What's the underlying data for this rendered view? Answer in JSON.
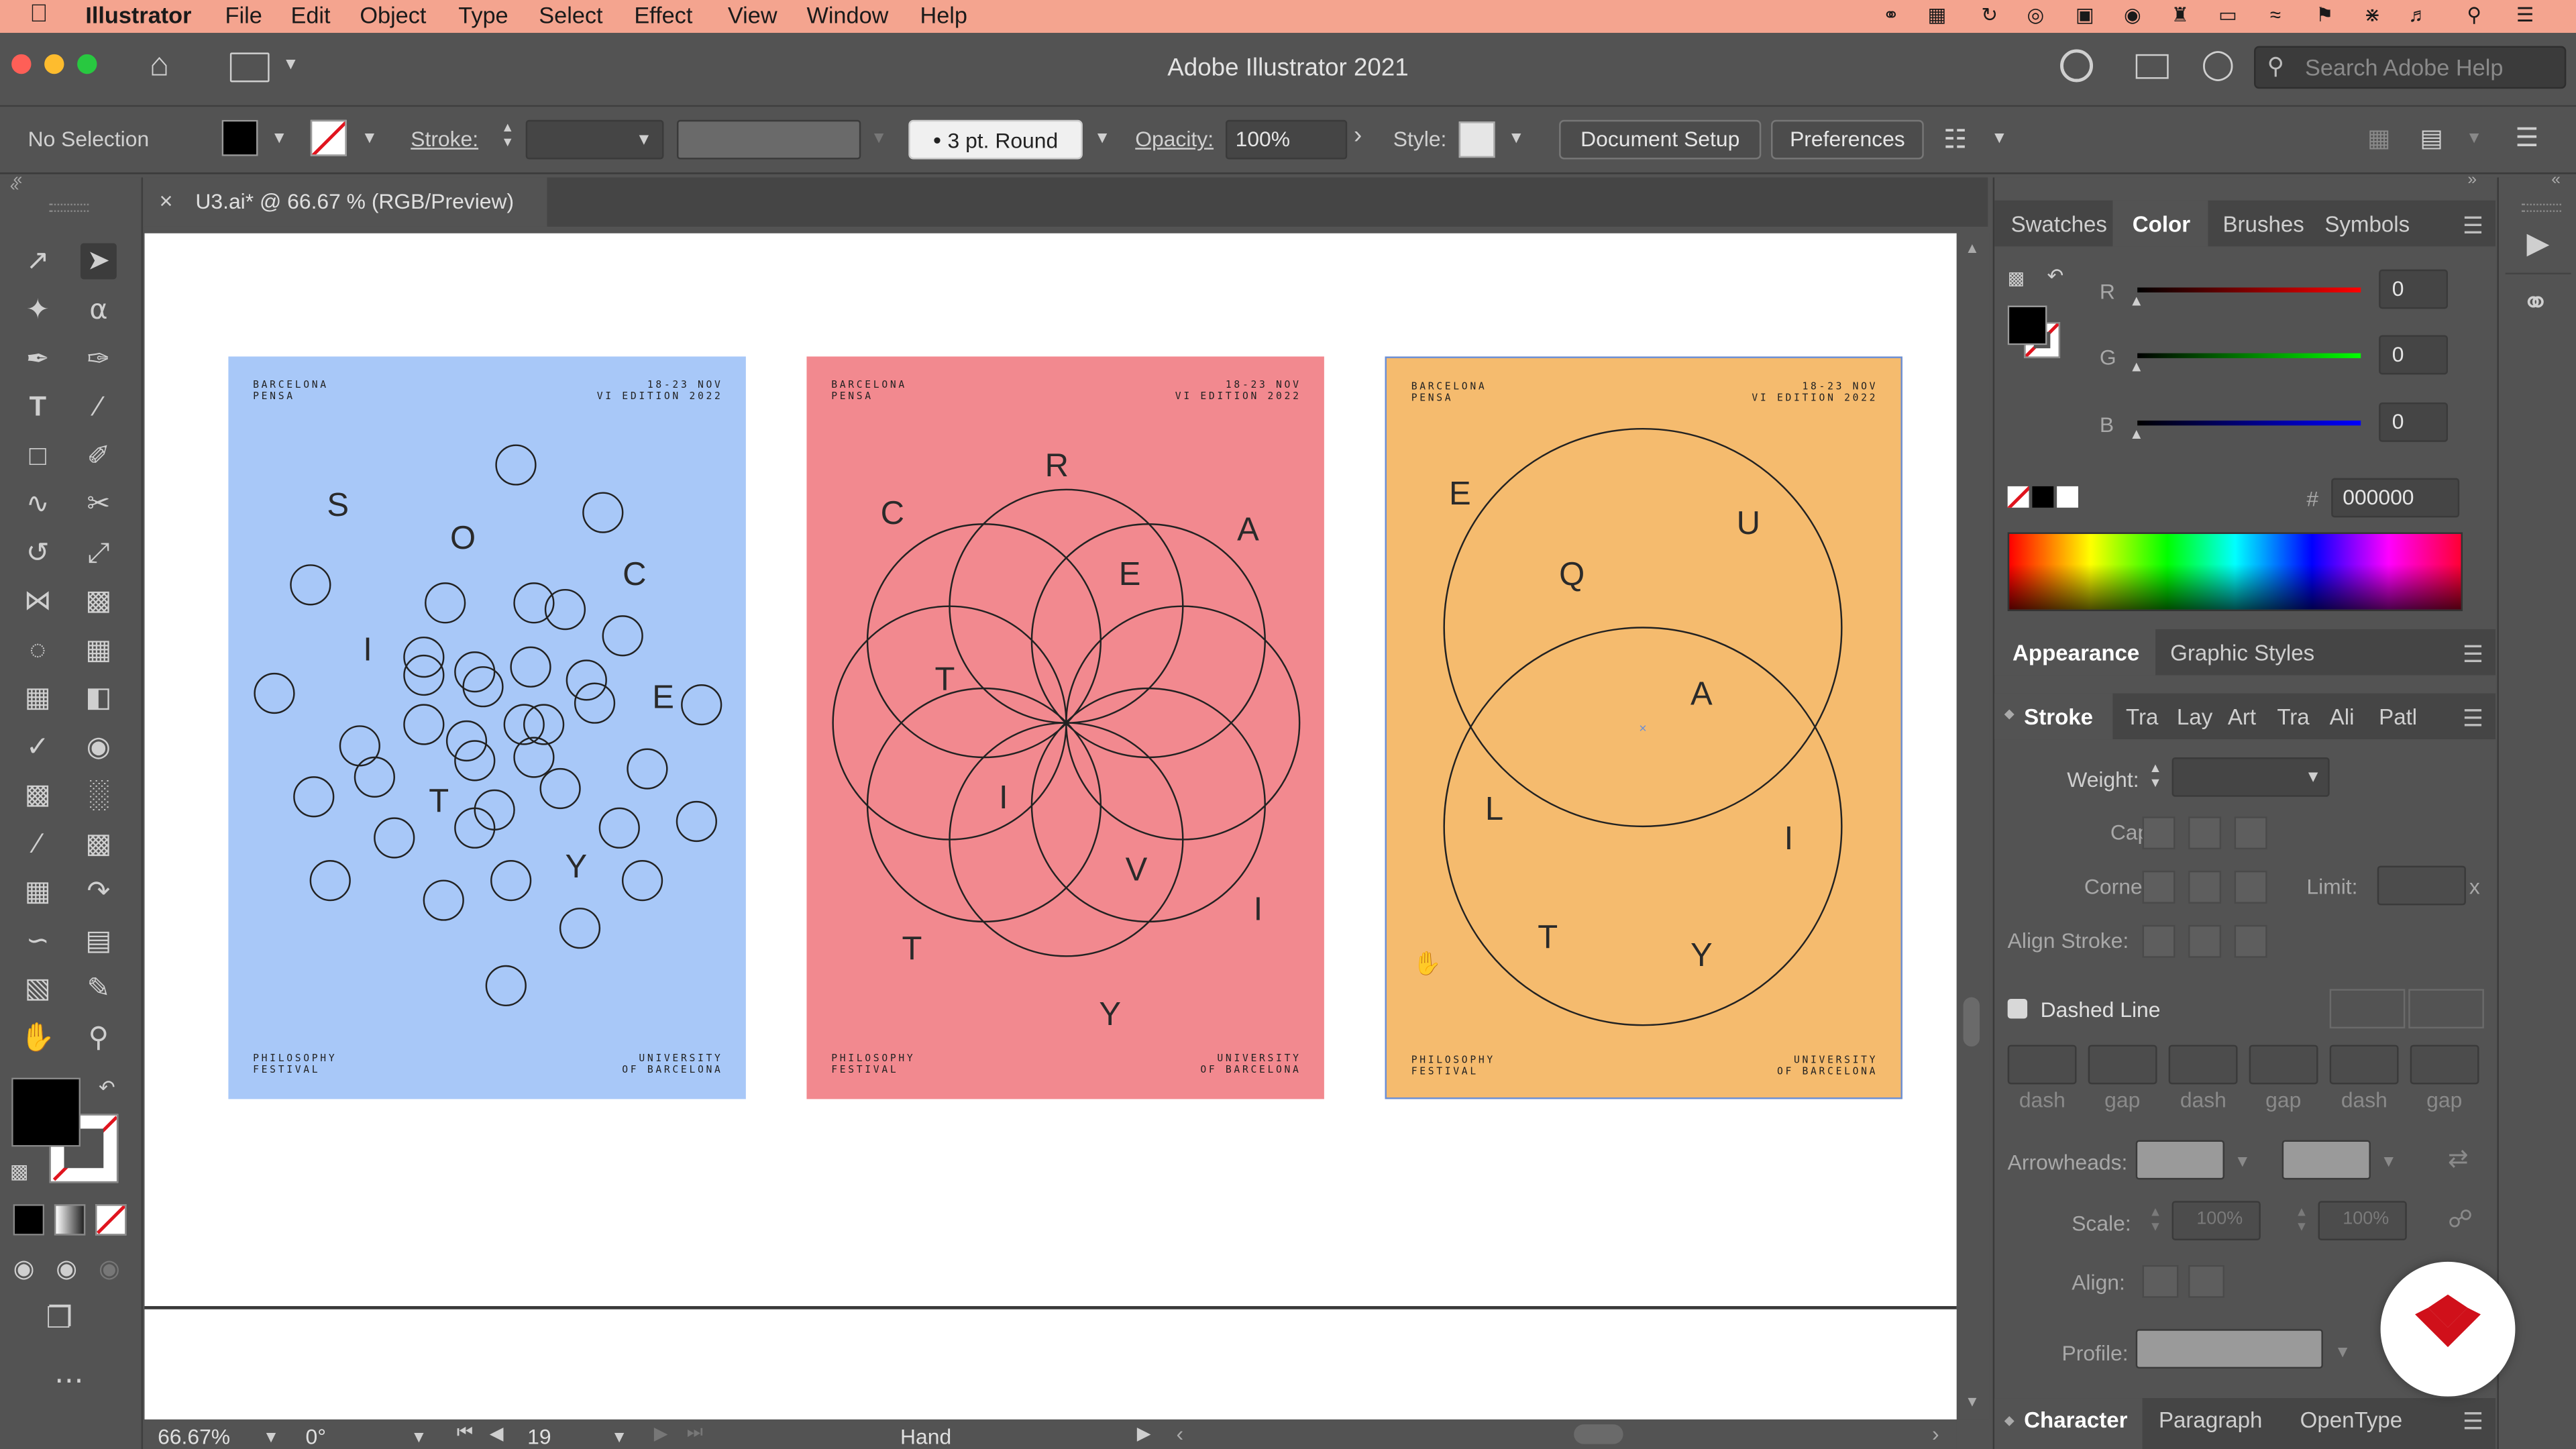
{
  "menubar": {
    "app_name": "Illustrator",
    "items": [
      "File",
      "Edit",
      "Object",
      "Type",
      "Select",
      "Effect",
      "View",
      "Window",
      "Help"
    ]
  },
  "window": {
    "title": "Adobe Illustrator 2021",
    "help_search_placeholder": "Search Adobe Help"
  },
  "control_bar": {
    "selection": "No Selection",
    "stroke_label": "Stroke:",
    "brush": "3 pt. Round",
    "opacity_label": "Opacity:",
    "opacity_value": "100%",
    "style_label": "Style:",
    "document_setup": "Document Setup",
    "preferences": "Preferences"
  },
  "document_tab": {
    "close": "×",
    "title": "U3.ai* @ 66.67 % (RGB/Preview)"
  },
  "artboards": [
    {
      "bg": "#a8c8f8",
      "top_left": [
        "BARCELONA",
        "PENSA"
      ],
      "top_right": [
        "18-23 NOV",
        "VI EDITION 2022"
      ],
      "bottom_left": [
        "PHILOSOPHY",
        "FESTIVAL"
      ],
      "bottom_right": [
        "UNIVERSITY",
        "OF BARCELONA"
      ],
      "letters": [
        "S",
        "O",
        "C",
        "I",
        "E",
        "T",
        "Y"
      ]
    },
    {
      "bg": "#f2898f",
      "top_left": [
        "BARCELONA",
        "PENSA"
      ],
      "top_right": [
        "18-23 NOV",
        "VI EDITION 2022"
      ],
      "bottom_left": [
        "PHILOSOPHY",
        "FESTIVAL"
      ],
      "bottom_right": [
        "UNIVERSITY",
        "OF BARCELONA"
      ],
      "letters": [
        "R",
        "C",
        "A",
        "E",
        "T",
        "I",
        "V",
        "I",
        "T",
        "Y"
      ]
    },
    {
      "bg": "#f5bb6e",
      "top_left": [
        "BARCELONA",
        "PENSA"
      ],
      "top_right": [
        "18-23 NOV",
        "VI EDITION 2022"
      ],
      "bottom_left": [
        "PHILOSOPHY",
        "FESTIVAL"
      ],
      "bottom_right": [
        "UNIVERSITY",
        "OF BARCELONA"
      ],
      "letters": [
        "E",
        "U",
        "Q",
        "A",
        "L",
        "I",
        "T",
        "Y"
      ]
    }
  ],
  "status_bar": {
    "zoom": "66.67%",
    "rotation": "0°",
    "artboard_number": "19",
    "tool": "Hand"
  },
  "color_panel": {
    "tabs": [
      "Swatches",
      "Color",
      "Brushes",
      "Symbols"
    ],
    "active_tab": "Color",
    "r_label": "R",
    "r_value": "0",
    "g_label": "G",
    "g_value": "0",
    "b_label": "B",
    "b_value": "0",
    "hash": "#",
    "hex": "000000"
  },
  "appearance_panel": {
    "tabs": [
      "Appearance",
      "Graphic Styles"
    ],
    "active_tab": "Appearance"
  },
  "stroke_panel": {
    "tabs": [
      "Stroke",
      "Tra",
      "Lay",
      "Art",
      "Tra",
      "Ali",
      "Patl"
    ],
    "weight": "Weight:",
    "cap": "Cap:",
    "corner": "Corner:",
    "limit": "Limit:",
    "limit_x": "x",
    "align_stroke": "Align Stroke:",
    "dashed_line": "Dashed Line",
    "dash_labels": [
      "dash",
      "gap",
      "dash",
      "gap",
      "dash",
      "gap"
    ],
    "arrowheads": "Arrowheads:",
    "scale": "Scale:",
    "scale_value_1": "100%",
    "scale_value_2": "100%",
    "align": "Align:",
    "profile": "Profile:"
  },
  "character_panel": {
    "tabs": [
      "Character",
      "Paragraph",
      "OpenType"
    ]
  },
  "colors": {
    "menubar_bg": "#f4a48f",
    "ui_bg": "#535353",
    "canvas_bg": "#ffffff",
    "badge_red": "#d0101a"
  }
}
